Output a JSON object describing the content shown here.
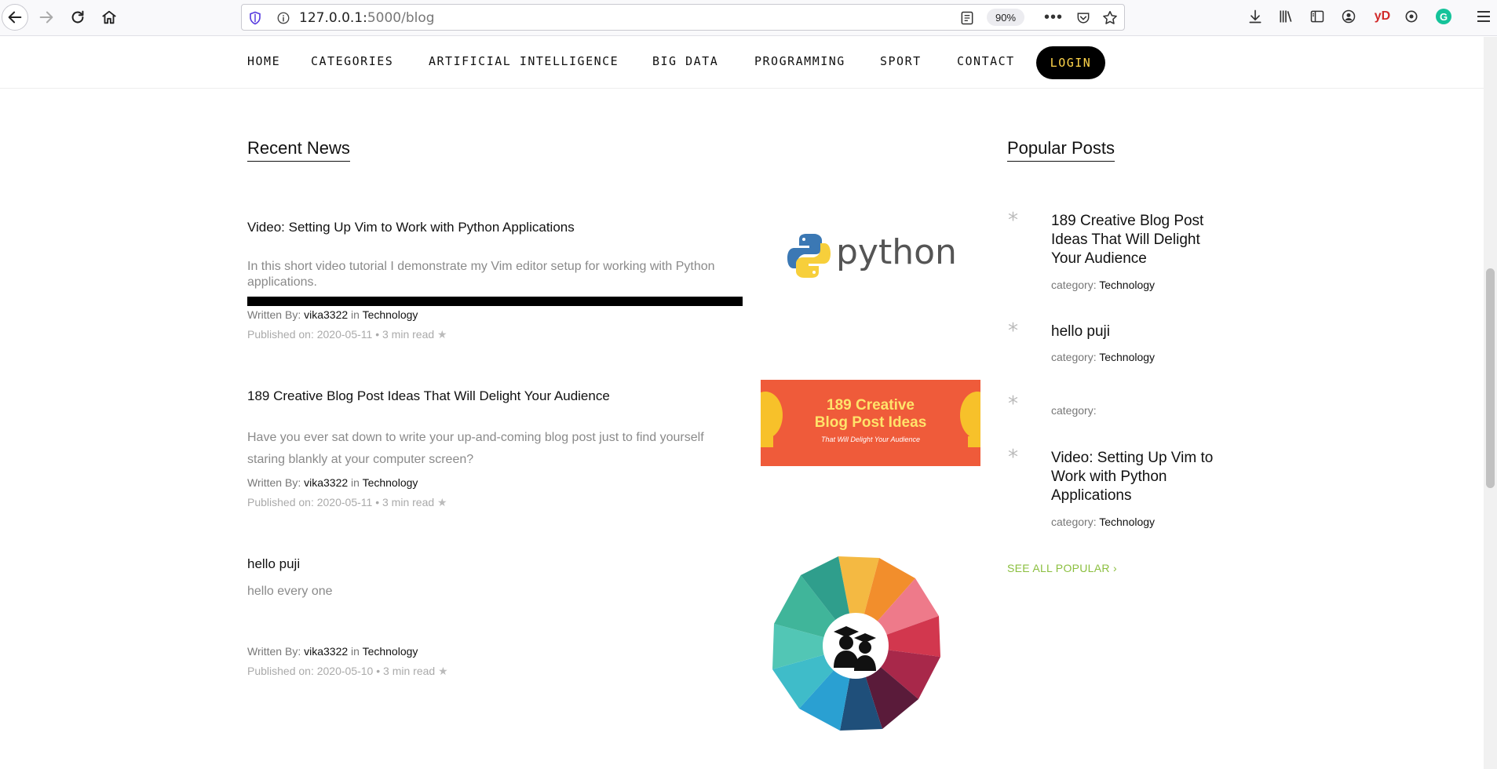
{
  "browser": {
    "url_host": "127.0.0.1:",
    "url_path": "5000/blog",
    "zoom": "90%",
    "more_glyph": "•••",
    "toolbar_icons": [
      "download-icon",
      "library-icon",
      "sidebar-icon",
      "account-icon",
      "yd-extension-icon",
      "sync-icon",
      "grammarly-icon",
      "menu-icon"
    ],
    "yd_label": "yD",
    "g_label": "G"
  },
  "nav": {
    "items": [
      "HOME",
      "CATEGORIES",
      "ARTIFICIAL INTELLIGENCE",
      "BIG DATA",
      "PROGRAMMING",
      "SPORT",
      "CONTACT"
    ],
    "login": "LOGIN"
  },
  "recent": {
    "title": "Recent News",
    "posts": [
      {
        "title": "Video: Setting Up Vim to Work with Python Applications",
        "excerpt": "In this short video tutorial I demonstrate my Vim editor setup for working with Python applications.",
        "written_by": "Written By:",
        "author": "vika3322",
        "in": "in",
        "category": "Technology",
        "published": "Published on: 2020-05-11",
        "sep": "•",
        "read": "3 min read",
        "star": "★",
        "thumb_text": "python"
      },
      {
        "title": "189 Creative Blog Post Ideas That Will Delight Your Audience",
        "excerpt": "Have you ever sat down to write your up-and-coming blog post just to find yourself staring blankly at your computer screen?",
        "written_by": "Written By:",
        "author": "vika3322",
        "in": "in",
        "category": "Technology",
        "published": "Published on: 2020-05-11",
        "sep": "•",
        "read": "3 min read",
        "star": "★",
        "thumb_line1": "189 Creative",
        "thumb_line2": "Blog Post Ideas",
        "thumb_line3": "That Will Delight Your Audience"
      },
      {
        "title": "hello puji",
        "excerpt": "hello every one",
        "written_by": "Written By:",
        "author": "vika3322",
        "in": "in",
        "category": "Technology",
        "published": "Published on: 2020-05-10",
        "sep": "•",
        "read": "3 min read",
        "star": "★"
      }
    ]
  },
  "popular": {
    "title": "Popular Posts",
    "asterisk": "*",
    "category_label": "category:",
    "items": [
      {
        "title": "189 Creative Blog Post Ideas That Will Delight Your Audience",
        "category": "Technology"
      },
      {
        "title": "hello puji",
        "category": "Technology"
      },
      {
        "title": "",
        "category": ""
      },
      {
        "title": "Video: Setting Up Vim to Work with Python Applications",
        "category": "Technology"
      }
    ],
    "see_all": "SEE ALL POPULAR",
    "see_all_arrow": "›"
  },
  "colors": {
    "accent_green": "#8bbf3f",
    "login_bg": "#000000",
    "login_text": "#ffd54a",
    "blog_thumb_bg": "#ef5b3a"
  }
}
